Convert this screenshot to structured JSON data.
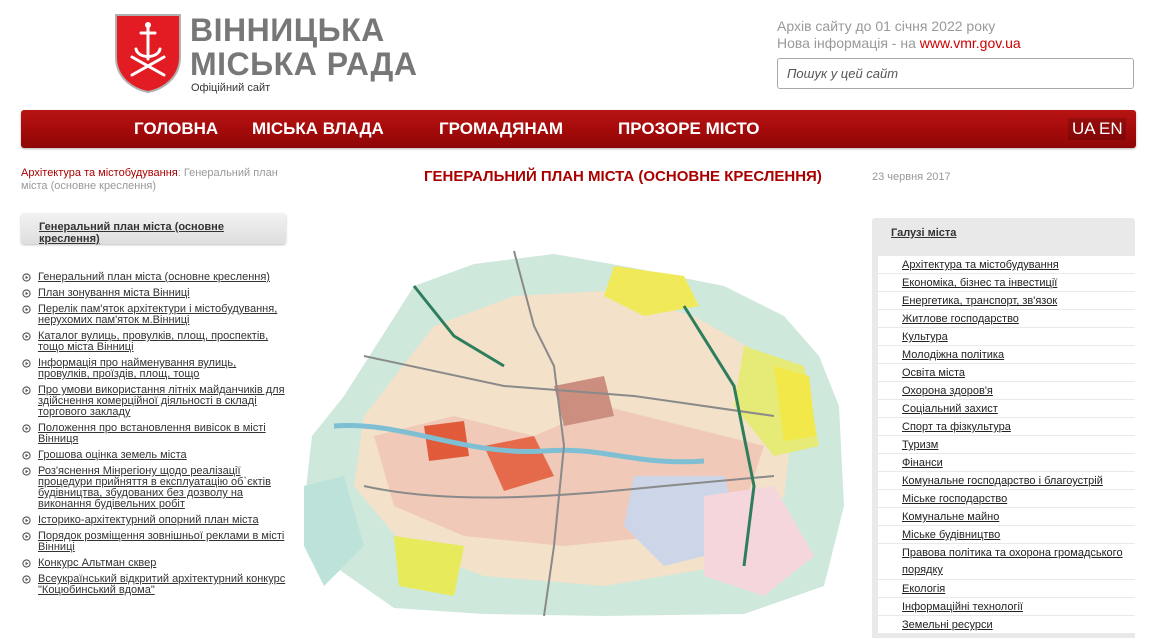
{
  "header": {
    "title_line1": "ВІННИЦЬКА",
    "title_line2": "МІСЬКА РАДА",
    "subtitle": "Офіційний сайт",
    "archive_line1": "Архів сайту до 01 січня 2022 року",
    "archive_line2_prefix": "Нова інформація - на ",
    "archive_link": "www.vmr.gov.ua",
    "search_placeholder": "Пошук у цей сайт"
  },
  "nav": {
    "items": [
      "ГОЛОВНА",
      "МІСЬКА ВЛАДА",
      "ГРОМАДЯНАМ",
      "ПРОЗОРЕ МІСТО"
    ],
    "lang_ua": "UA",
    "lang_en": "EN"
  },
  "breadcrumb": {
    "parent": "Архітектура та містобудування",
    "separator": ": ",
    "current": "Генеральний план міста (основне креслення)"
  },
  "page": {
    "title": "ГЕНЕРАЛЬНИЙ ПЛАН МІСТА (ОСНОВНЕ КРЕСЛЕННЯ)",
    "date": "23 червня 2017"
  },
  "left_panel": {
    "header": "Генеральний план міста (основне креслення)",
    "items": [
      "Генеральний план міста (основне креслення)",
      "План зонування міста Вінниці",
      "Перелік пам'яток архітектури і містобудування, нерухомих пам'яток м.Вінниці",
      "Каталог вулиць, провулків, площ, проспектів, тощо міста Вінниці",
      "Інформація про найменування вулиць, провулків, проїздів, площ, тощо",
      "Про умови використання літніх майданчиків для здійснення комерційної діяльності в складі торгового закладу",
      "Положення про встановлення вивісок в місті Вінниця",
      "Грошова оцінка земель міста",
      "Роз'яснення Мінрегіону щодо реалізації процедури прийняття в експлуатацію об`єктів будівництва, збудованих без дозволу на виконання будівельних робіт",
      "Історико-архітектурний опорний план міста",
      "Порядок розміщення зовнішньої реклами в місті Вінниці",
      "Конкурс Альтман сквер",
      "Всеукраїнський відкритий архітектурний конкурс \"Коцюбинський вдома\""
    ]
  },
  "right_panel": {
    "header": "Галузі міста",
    "items": [
      "Архітектура та містобудування",
      "Економіка, бізнес та інвестиції",
      "Енергетика, транспорт, зв'язок",
      "Житлове господарство",
      "Культура",
      "Молодіжна політика",
      "Освіта міста",
      "Охорона здоров'я",
      "Соціальний захист",
      "Спорт та фізкультура",
      "Туризм",
      "Фінанси",
      "Комунальне господарство і благоустрій",
      "Міське господарство",
      "Комунальне майно",
      "Міське будівництво",
      "Правова політика та охорона громадського порядку",
      "Екологія",
      "Інформаційні технології",
      "Земельні ресурси"
    ]
  },
  "colors": {
    "brand_red": "#a40a0a",
    "link_red": "#aa0000",
    "gray_text": "#777777"
  }
}
